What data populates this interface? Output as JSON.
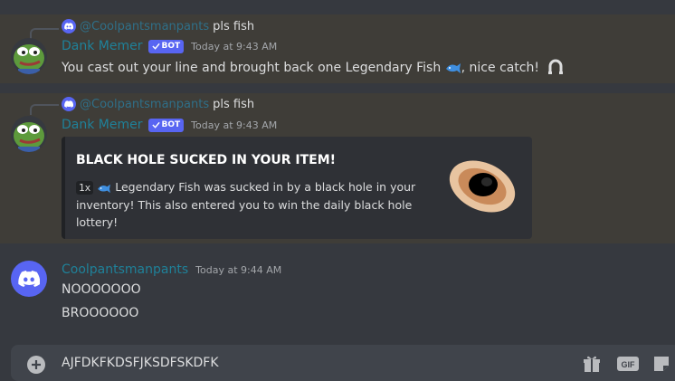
{
  "messages": [
    {
      "reply": {
        "username": "@Coolpantsmanpants",
        "text": "pls fish"
      },
      "author": "Dank Memer",
      "badge": "BOT",
      "timestamp": "Today at 9:43 AM",
      "content_before": "You cast out your line and brought back one Legendary Fish",
      "content_after": ", nice catch!"
    },
    {
      "reply": {
        "username": "@Coolpantsmanpants",
        "text": "pls fish"
      },
      "author": "Dank Memer",
      "badge": "BOT",
      "timestamp": "Today at 9:43 AM",
      "embed": {
        "title": "BLACK HOLE SUCKED IN YOUR ITEM!",
        "quantity": "1x",
        "description": "Legendary Fish was sucked in by a black hole in your inventory! This also entered you to win the daily black hole lottery!"
      }
    },
    {
      "author": "Coolpantsmanpants",
      "timestamp": "Today at 9:44 AM",
      "lines": [
        "NOOOOOOO",
        "BROOOOOO"
      ]
    }
  ],
  "composer": {
    "value": "AJFDKFKDSFJKSDFSKDFK"
  },
  "icons": [
    "discord-logo-icon",
    "bot-check-icon",
    "legendary-fish-icon",
    "horseshoe-icon",
    "black-hole-icon",
    "add-icon",
    "gift-icon",
    "gif-icon",
    "sticker-icon"
  ],
  "colors": {
    "background": "#36393f",
    "highlight": "#3f3d38",
    "blurple": "#5865f2",
    "embed_bg": "#2f3136"
  }
}
